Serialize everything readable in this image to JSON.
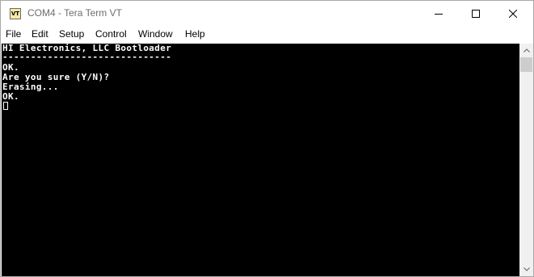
{
  "window": {
    "title": "COM4 - Tera Term VT",
    "icon_label": "VT",
    "controls": {
      "minimize": "minimize-icon",
      "maximize": "maximize-icon",
      "close": "close-icon"
    }
  },
  "menu": {
    "items": [
      {
        "label": "File"
      },
      {
        "label": "Edit"
      },
      {
        "label": "Setup"
      },
      {
        "label": "Control"
      },
      {
        "label": "Window"
      },
      {
        "label": "Help"
      }
    ]
  },
  "terminal": {
    "lines": [
      "HI Electronics, LLC Bootloader",
      "------------------------------",
      "OK.",
      "Are you sure (Y/N)?",
      "Erasing...",
      "OK."
    ],
    "background": "#000000",
    "foreground": "#ffffff"
  }
}
